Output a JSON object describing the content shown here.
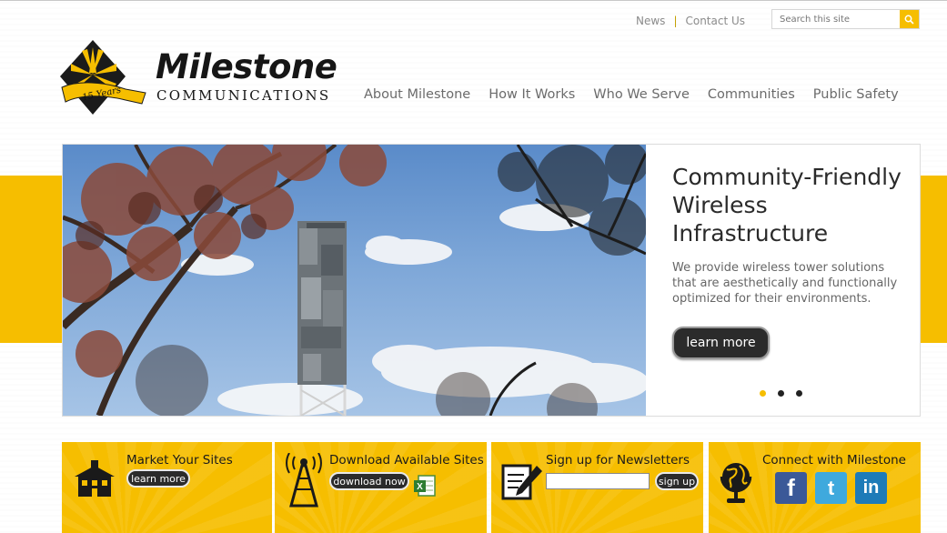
{
  "utility_nav": {
    "news": "News",
    "separator": "|",
    "contact": "Contact Us"
  },
  "search": {
    "placeholder": "Search this site",
    "icon": "search-icon"
  },
  "logo": {
    "wordmark": "Milestone",
    "subtitle": "COMMUNICATIONS",
    "ribbon": "15 Years"
  },
  "main_nav": [
    {
      "label": "About Milestone"
    },
    {
      "label": "How It Works"
    },
    {
      "label": "Who We Serve"
    },
    {
      "label": "Communities"
    },
    {
      "label": "Public Safety"
    }
  ],
  "hero": {
    "title": "Community-Friendly Wireless Infrastructure",
    "body": "We provide wireless tower solutions that are aesthetically and functionally optimized for their environments.",
    "button": "learn more",
    "slides_total": 3,
    "active_slide": 1
  },
  "boxes": {
    "market": {
      "title": "Market Your Sites",
      "button": "learn more",
      "icon": "building-icon"
    },
    "download": {
      "title": "Download Available Sites",
      "button": "download now",
      "icon": "tower-icon",
      "file_icon": "excel-icon"
    },
    "newsletter": {
      "title": "Sign up for Newsletters",
      "button": "sign up",
      "icon": "pen-paper-icon"
    },
    "connect": {
      "title": "Connect with Milestone",
      "icon": "globe-icon",
      "social": [
        {
          "name": "facebook-icon",
          "glyph": "f",
          "color": "#3b5998"
        },
        {
          "name": "twitter-icon",
          "glyph": "t",
          "color": "#3fa9dd"
        },
        {
          "name": "linkedin-icon",
          "glyph": "in",
          "color": "#1e7bb8"
        }
      ]
    }
  },
  "colors": {
    "accent": "#f6be00",
    "dark": "#2b2b2b"
  }
}
